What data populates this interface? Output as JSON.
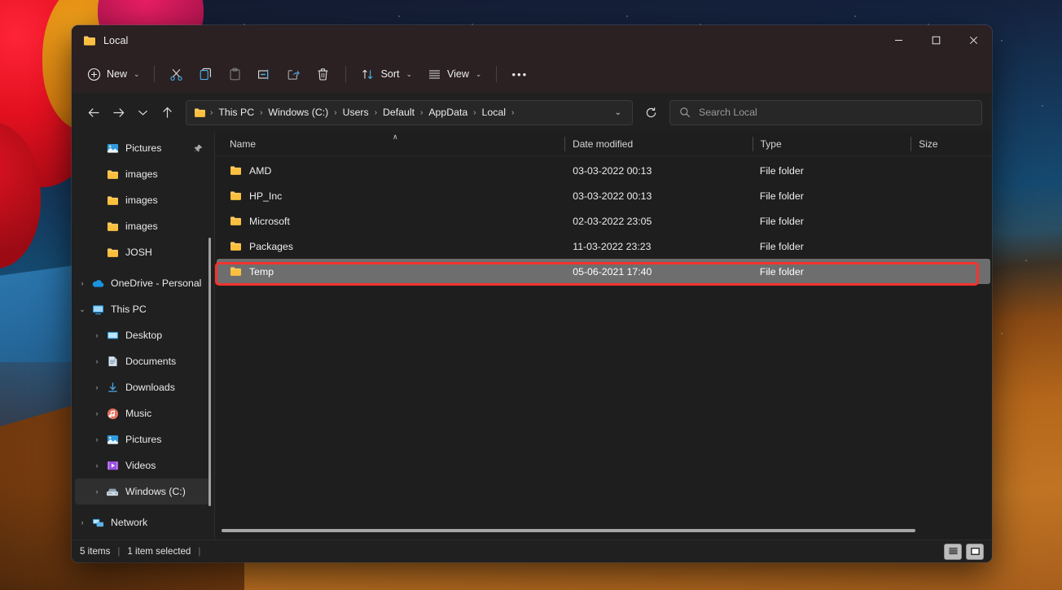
{
  "window": {
    "title": "Local",
    "folder_icon": "folder-icon",
    "controls": {
      "minimize": "—",
      "maximize": "□",
      "close": "✕"
    }
  },
  "toolbar": {
    "new_label": "New",
    "new_icon": "plus-circle-icon",
    "cut_icon": "scissors-icon",
    "copy_icon": "copy-icon",
    "paste_icon": "paste-icon",
    "rename_icon": "rename-icon",
    "share_icon": "share-icon",
    "delete_icon": "trash-icon",
    "sort_label": "Sort",
    "sort_icon": "sort-arrows-icon",
    "view_label": "View",
    "view_icon": "list-lines-icon",
    "more_label": "•••",
    "chevron": "⌄",
    "accent_color": "#4cb1e8"
  },
  "navbar": {
    "back_icon": "←",
    "forward_icon": "→",
    "recent_icon": "⌄",
    "up_icon": "↑",
    "address_folder_icon": "folder-icon",
    "breadcrumbs": [
      "This PC",
      "Windows (C:)",
      "Users",
      "Default",
      "AppData",
      "Local"
    ],
    "separator": "›",
    "dropdown_chevron": "⌄",
    "refresh_icon": "refresh-icon",
    "search_placeholder": "Search Local",
    "search_value": "",
    "search_icon": "search-icon"
  },
  "sidebar": {
    "items": [
      {
        "label": "Pictures",
        "icon": "pictures-icon",
        "twisty": "",
        "indent": 1,
        "pinned": true,
        "selected": false
      },
      {
        "label": "images",
        "icon": "folder-icon",
        "twisty": "",
        "indent": 1,
        "pinned": false,
        "selected": false
      },
      {
        "label": "images",
        "icon": "folder-icon",
        "twisty": "",
        "indent": 1,
        "pinned": false,
        "selected": false
      },
      {
        "label": "images",
        "icon": "folder-icon",
        "twisty": "",
        "indent": 1,
        "pinned": false,
        "selected": false
      },
      {
        "label": "JOSH",
        "icon": "folder-icon",
        "twisty": "",
        "indent": 1,
        "pinned": false,
        "selected": false
      },
      {
        "label": "OneDrive - Personal",
        "icon": "onedrive-icon",
        "twisty": "›",
        "indent": 0,
        "pinned": false,
        "selected": false
      },
      {
        "label": "This PC",
        "icon": "thispc-icon",
        "twisty": "⌄",
        "indent": 0,
        "pinned": false,
        "selected": false
      },
      {
        "label": "Desktop",
        "icon": "desktop-icon",
        "twisty": "›",
        "indent": 1,
        "pinned": false,
        "selected": false
      },
      {
        "label": "Documents",
        "icon": "documents-icon",
        "twisty": "›",
        "indent": 1,
        "pinned": false,
        "selected": false
      },
      {
        "label": "Downloads",
        "icon": "downloads-icon",
        "twisty": "›",
        "indent": 1,
        "pinned": false,
        "selected": false
      },
      {
        "label": "Music",
        "icon": "music-icon",
        "twisty": "›",
        "indent": 1,
        "pinned": false,
        "selected": false
      },
      {
        "label": "Pictures",
        "icon": "pictures-icon",
        "twisty": "›",
        "indent": 1,
        "pinned": false,
        "selected": false
      },
      {
        "label": "Videos",
        "icon": "videos-icon",
        "twisty": "›",
        "indent": 1,
        "pinned": false,
        "selected": false
      },
      {
        "label": "Windows (C:)",
        "icon": "drive-icon",
        "twisty": "›",
        "indent": 1,
        "pinned": false,
        "selected": true
      },
      {
        "label": "Network",
        "icon": "network-icon",
        "twisty": "›",
        "indent": 0,
        "pinned": false,
        "selected": false
      }
    ],
    "pin_glyph": "📌"
  },
  "filelist": {
    "columns": [
      {
        "label": "Name"
      },
      {
        "label": "Date modified"
      },
      {
        "label": "Type"
      },
      {
        "label": "Size"
      }
    ],
    "sort_indicator": "∧",
    "rows": [
      {
        "name": "AMD",
        "date": "03-03-2022 00:13",
        "type": "File folder",
        "size": "",
        "icon": "folder-icon",
        "selected": false
      },
      {
        "name": "HP_Inc",
        "date": "03-03-2022 00:13",
        "type": "File folder",
        "size": "",
        "icon": "folder-icon",
        "selected": false
      },
      {
        "name": "Microsoft",
        "date": "02-03-2022 23:05",
        "type": "File folder",
        "size": "",
        "icon": "folder-icon",
        "selected": false
      },
      {
        "name": "Packages",
        "date": "11-03-2022 23:23",
        "type": "File folder",
        "size": "",
        "icon": "folder-icon",
        "selected": false
      },
      {
        "name": "Temp",
        "date": "05-06-2021 17:40",
        "type": "File folder",
        "size": "",
        "icon": "folder-icon",
        "selected": true
      }
    ],
    "highlight_color": "#f4332e",
    "selection_color": "#6e6e6e"
  },
  "statusbar": {
    "item_count": "5 items",
    "separator": "|",
    "selection_text": "1 item selected",
    "trailing_separator": "|",
    "details_view_icon": "details-view-icon",
    "large_icons_view_icon": "large-icons-view-icon"
  }
}
